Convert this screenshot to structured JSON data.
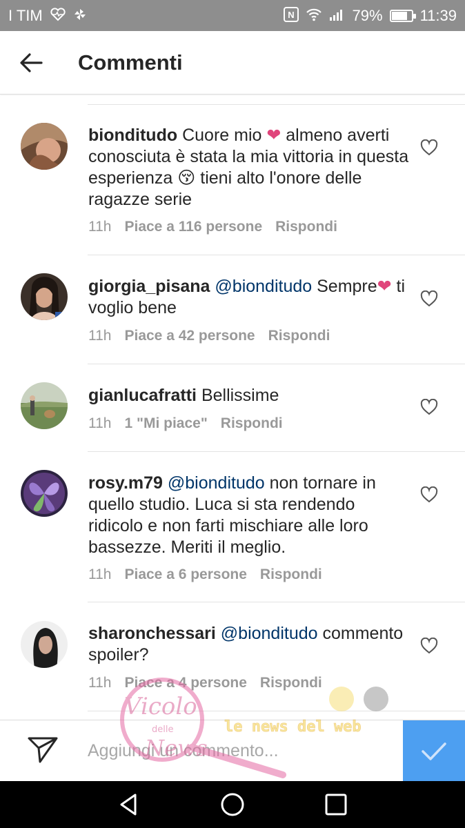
{
  "status_bar": {
    "carrier": "I TIM",
    "nfc_label": "N",
    "battery": "79%",
    "battery_level": 0.79,
    "time": "11:39"
  },
  "header": {
    "title": "Commenti",
    "back_icon": "arrow-left-icon"
  },
  "comments": [
    {
      "username": "bionditudo",
      "segments": [
        {
          "text": "Cuore mio ",
          "type": "text"
        },
        {
          "text": "❤",
          "type": "emoji-heart"
        },
        {
          "text": " almeno averti conosciuta è stata la mia vittoria in questa esperienza ",
          "type": "text"
        },
        {
          "text": "😚",
          "type": "emoji"
        },
        {
          "text": " tieni alto l'onore delle ragazze serie",
          "type": "text"
        }
      ],
      "time": "11h",
      "likes": "Piace a 116 persone",
      "reply": "Rispondi"
    },
    {
      "username": "giorgia_pisana",
      "segments": [
        {
          "text": "@bionditudo",
          "type": "mention"
        },
        {
          "text": " Sempre",
          "type": "text"
        },
        {
          "text": "❤",
          "type": "emoji-heart"
        },
        {
          "text": " ti voglio bene",
          "type": "text"
        }
      ],
      "time": "11h",
      "likes": "Piace a 42 persone",
      "reply": "Rispondi"
    },
    {
      "username": "gianlucafratti",
      "segments": [
        {
          "text": "Bellissime",
          "type": "text"
        }
      ],
      "time": "11h",
      "likes": "1 \"Mi piace\"",
      "reply": "Rispondi"
    },
    {
      "username": "rosy.m79",
      "segments": [
        {
          "text": "@bionditudo",
          "type": "mention"
        },
        {
          "text": " non tornare in quello studio. Luca si sta rendendo ridicolo e non farti mischiare alle loro bassezze. Meriti il meglio.",
          "type": "text"
        }
      ],
      "time": "11h",
      "likes": "Piace a 6 persone",
      "reply": "Rispondi"
    },
    {
      "username": "sharonchessari",
      "segments": [
        {
          "text": "@bionditudo",
          "type": "mention"
        },
        {
          "text": " commento spoiler?",
          "type": "text"
        }
      ],
      "time": "11h",
      "likes": "Piace a 4 persone",
      "reply": "Rispondi"
    }
  ],
  "input_bar": {
    "placeholder": "Aggiungi un commento...",
    "send_icon": "paper-plane-icon",
    "post_icon": "checkmark-icon"
  },
  "watermark": {
    "line1": "Vicolo",
    "line2": "delle",
    "line3": "News",
    "tagline": "le news del web"
  },
  "colors": {
    "status_bar": "#8e8e8e",
    "mention": "#003569",
    "meta": "#999999",
    "post_button": "#4d9ff1",
    "heart_emoji": "#e0457b"
  }
}
